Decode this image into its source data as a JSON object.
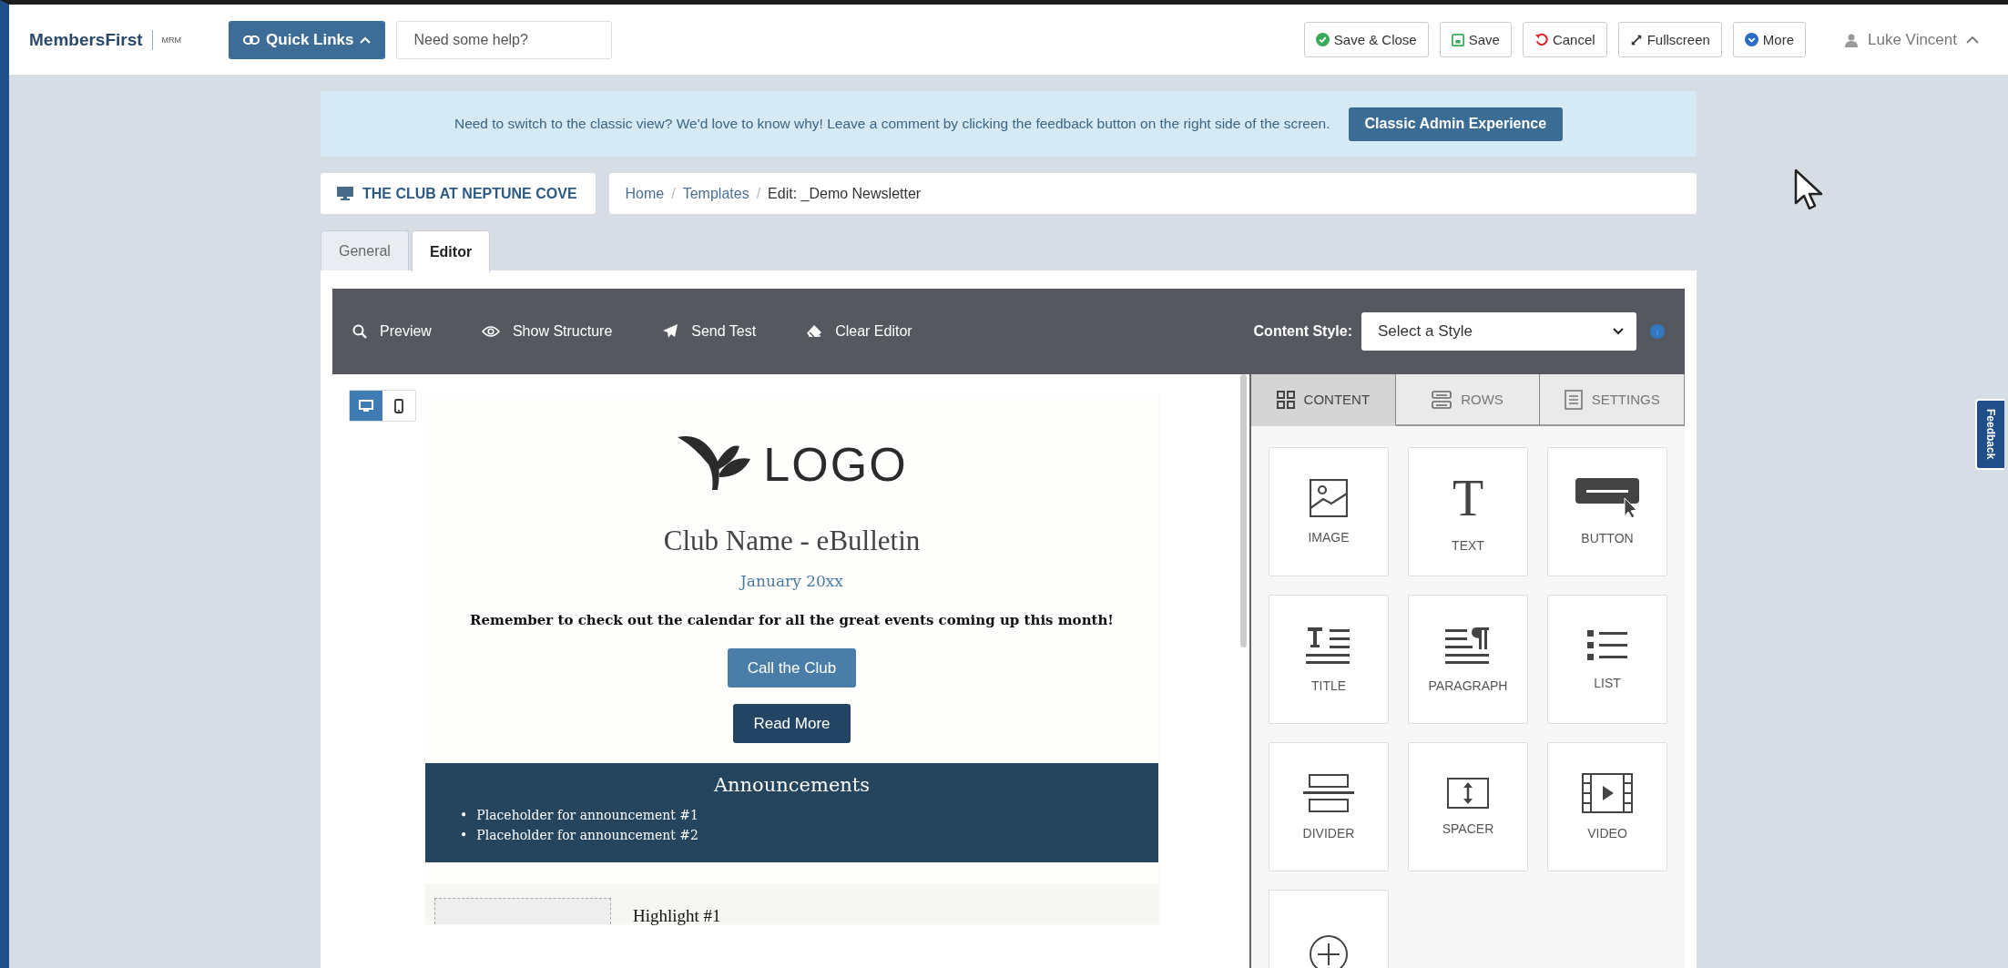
{
  "header": {
    "logo": "MembersFirst",
    "logo_tag": "MRM",
    "quick_links": "Quick Links",
    "search": {
      "placeholder": "Need some help?"
    }
  },
  "actions": [
    {
      "label": "Save & Close",
      "kind": "check"
    },
    {
      "label": "Save",
      "kind": "save"
    },
    {
      "label": "Cancel",
      "kind": "undo"
    },
    {
      "label": "Fullscreen",
      "kind": "expand"
    },
    {
      "label": "More",
      "kind": "more"
    }
  ],
  "user": {
    "name": "Luke Vincent"
  },
  "banner": {
    "text": "Need to switch to the classic view? We'd love to know why! Leave a comment by clicking the feedback button on the right side of the screen.",
    "button": "Classic Admin Experience"
  },
  "site": "THE CLUB AT NEPTUNE COVE",
  "breadcrumb": [
    "Home",
    "Templates",
    "Edit: _Demo Newsletter"
  ],
  "breadcrumb_separator": "/",
  "tabs": [
    {
      "label": "General",
      "selected": false
    },
    {
      "label": "Editor",
      "selected": true
    }
  ],
  "toolbar": {
    "tools": [
      {
        "label": "Preview",
        "kind": "search"
      },
      {
        "label": "Show Structure",
        "kind": "eye"
      },
      {
        "label": "Send Test",
        "kind": "send"
      },
      {
        "label": "Clear Editor",
        "kind": "eraser"
      }
    ],
    "style_label": "Content Style:",
    "style_value": "Select a Style"
  },
  "view_toggle": [
    {
      "kind": "desktop",
      "selected": true
    },
    {
      "kind": "mobile",
      "selected": false
    }
  ],
  "email": {
    "logo": "LOGO",
    "title": "Club Name - eBulletin",
    "date": "January 20xx",
    "intro": "Remember to check out the calendar for all the great events coming up this month!",
    "buttons": [
      {
        "label": "Call the Club",
        "kind": "primary"
      },
      {
        "label": "Read More",
        "kind": "dark"
      }
    ],
    "announcements": {
      "title": "Announcements",
      "bullet": "•",
      "items": [
        "Placeholder for announcement #1",
        "Placeholder for announcement #2"
      ]
    },
    "highlight": {
      "title": "Highlight #1"
    }
  },
  "panel_tabs": [
    {
      "label": "CONTENT",
      "kind": "grid",
      "selected": true
    },
    {
      "label": "ROWS",
      "kind": "rows",
      "selected": false
    },
    {
      "label": "SETTINGS",
      "kind": "settings",
      "selected": false
    }
  ],
  "blocks": [
    {
      "label": "IMAGE",
      "kind": "image"
    },
    {
      "label": "TEXT",
      "kind": "text",
      "glyph": "T"
    },
    {
      "label": "BUTTON",
      "kind": "button"
    },
    {
      "label": "TITLE",
      "kind": "title"
    },
    {
      "label": "PARAGRAPH",
      "kind": "paragraph"
    },
    {
      "label": "LIST",
      "kind": "list"
    },
    {
      "label": "DIVIDER",
      "kind": "divider"
    },
    {
      "label": "SPACER",
      "kind": "spacer"
    },
    {
      "label": "VIDEO",
      "kind": "video"
    },
    {
      "kind": "add"
    }
  ],
  "feedback": "Feedback"
}
